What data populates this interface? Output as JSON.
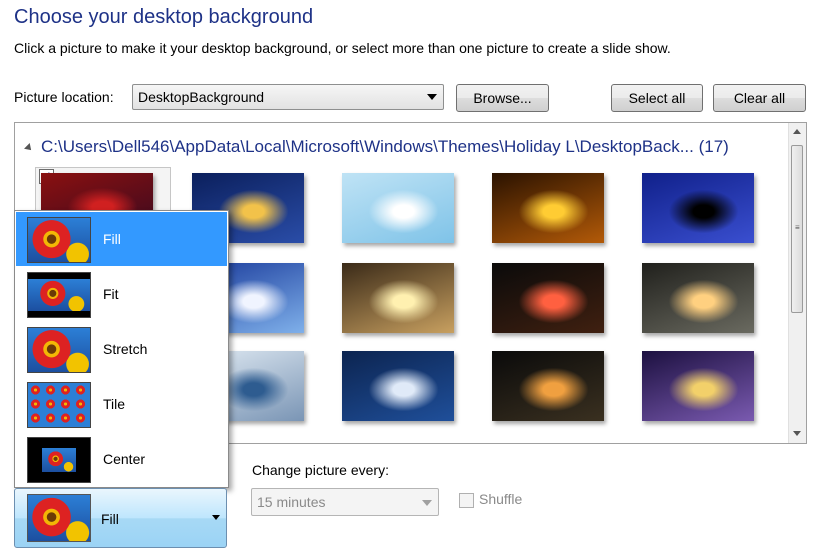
{
  "header": {
    "title": "Choose your desktop background",
    "description": "Click a picture to make it your desktop background, or select more than one picture to create a slide show."
  },
  "location": {
    "label": "Picture location:",
    "value": "DesktopBackground",
    "browse_label": "Browse...",
    "select_all_label": "Select all",
    "clear_all_label": "Clear all"
  },
  "gallery": {
    "group_title": "C:\\Users\\Dell546\\AppData\\Local\\Microsoft\\Windows\\Themes\\Holiday L\\DesktopBack... (17)",
    "selected_checkbox": "✓",
    "thumbnails": [
      {
        "name": "lights-wreath",
        "colors": [
          "#8a1010",
          "#3a0a20",
          "#d02020"
        ]
      },
      {
        "name": "christmas-tree-night",
        "colors": [
          "#0b1f5c",
          "#2a4da8",
          "#f2c24a"
        ]
      },
      {
        "name": "snowflakes-blue",
        "colors": [
          "#bfe3f5",
          "#7fc3e8",
          "#ffffff"
        ]
      },
      {
        "name": "golden-lanterns",
        "colors": [
          "#2a1200",
          "#b35a08",
          "#ffcc33"
        ]
      },
      {
        "name": "palm-trees-lights",
        "colors": [
          "#10208a",
          "#3a4fd0",
          "#000000"
        ]
      },
      {
        "name": "winter-lake-dusk",
        "colors": [
          "#1b3c9c",
          "#7fb0ea",
          "#f0f4ff"
        ]
      },
      {
        "name": "candles-ornaments",
        "colors": [
          "#3a2a18",
          "#c8a060",
          "#fff0b0"
        ]
      },
      {
        "name": "string-lights",
        "colors": [
          "#0a0a0a",
          "#402010",
          "#ff6040"
        ]
      },
      {
        "name": "candle-wreath",
        "colors": [
          "#20201c",
          "#6a6a60",
          "#ffd080"
        ]
      },
      {
        "name": "silver-ornaments",
        "colors": [
          "#dfe9f2",
          "#7a95b5",
          "#2e5c90"
        ]
      },
      {
        "name": "snowy-river",
        "colors": [
          "#0c2450",
          "#1f4f9a",
          "#e0eaf8"
        ]
      },
      {
        "name": "frosted-window",
        "colors": [
          "#0a0a0a",
          "#3a3020",
          "#f0a040"
        ]
      },
      {
        "name": "desert-cactus-lights",
        "colors": [
          "#1c1040",
          "#7a5ab0",
          "#f2d06a"
        ]
      }
    ]
  },
  "position_menu": {
    "items": [
      {
        "label": "Fill",
        "icon": "fill-icon",
        "active": true
      },
      {
        "label": "Fit",
        "icon": "fit-icon",
        "active": false
      },
      {
        "label": "Stretch",
        "icon": "stretch-icon",
        "active": false
      },
      {
        "label": "Tile",
        "icon": "tile-icon",
        "active": false
      },
      {
        "label": "Center",
        "icon": "center-icon",
        "active": false
      }
    ],
    "current": "Fill"
  },
  "slideshow": {
    "change_label": "Change picture every:",
    "interval_value": "15 minutes",
    "shuffle_label": "Shuffle"
  },
  "colors": {
    "heading": "#1e3287",
    "menu_highlight": "#3399ff"
  }
}
